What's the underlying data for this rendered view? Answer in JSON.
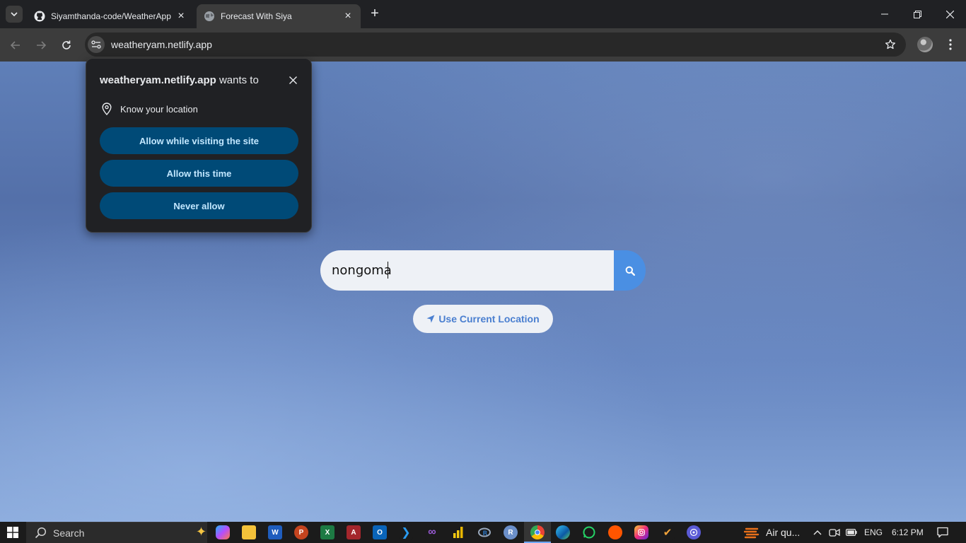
{
  "browser": {
    "tabs": [
      {
        "title": "Siyamthanda-code/WeatherApp",
        "active": false,
        "favicon": "github-icon"
      },
      {
        "title": "Forecast With Siya",
        "active": true,
        "favicon": "globe-icon"
      }
    ],
    "url": "weatheryam.netlify.app"
  },
  "permission_popup": {
    "site": "weatheryam.netlify.app",
    "wants_to": "wants to",
    "request": "Know your location",
    "buttons": {
      "allow_while_visiting": "Allow while visiting the site",
      "allow_this_time": "Allow this time",
      "never_allow": "Never allow"
    }
  },
  "page": {
    "search_value": "nongoma",
    "location_button": "Use Current Location"
  },
  "taskbar": {
    "search_label": "Search",
    "weather_label": "Air qu...",
    "language": "ENG",
    "time": "6:12 PM"
  },
  "colors": {
    "popup_button_bg": "#004a77",
    "popup_button_text": "#c2e7ff",
    "search_button": "#4a8fe3",
    "accent_text": "#4a7fd0"
  }
}
